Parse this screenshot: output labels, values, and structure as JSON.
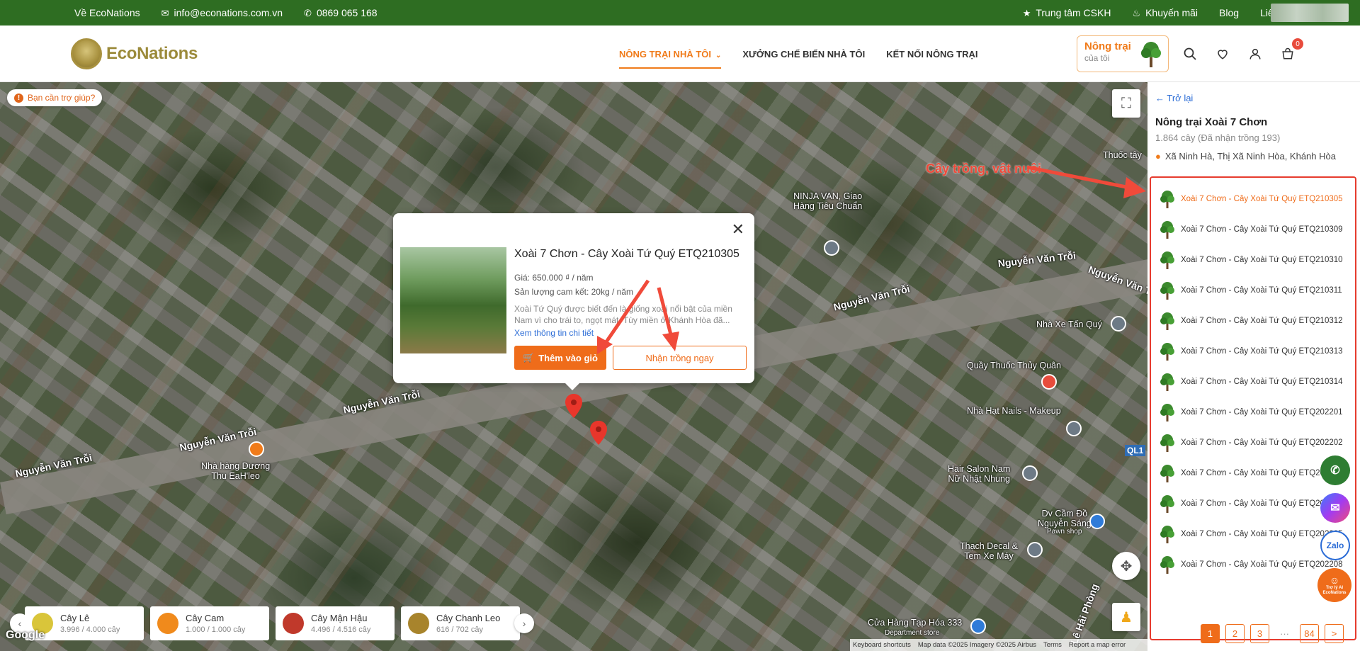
{
  "topbar": {
    "about": "Về EcoNations",
    "email": "info@econations.com.vn",
    "phone": "0869 065 168",
    "support": "Trung tâm CSKH",
    "promo": "Khuyến mãi",
    "blog": "Blog",
    "contact": "Liên hệ"
  },
  "header": {
    "brand": "EcoNations",
    "nav": [
      "NÔNG TRẠI NHÀ TÔI",
      "XƯỞNG CHẾ BIẾN NHÀ TÔI",
      "KẾT NỐI NÔNG TRẠI"
    ],
    "myfarm_title": "Nông trại",
    "myfarm_sub": "của tôi",
    "cart_count": "0"
  },
  "map": {
    "help": "Bạn cần trợ giúp?",
    "roads": [
      "Nguyễn Văn Trỗi",
      "Nguyễn Văn Trỗi",
      "Nguyễn Văn Trỗi",
      "Nguyễn Văn Trỗi",
      "Nguyễn Văn Trỗi",
      "Nguyễn Văn Trỗi",
      "Lê Hải Phòng",
      "QL1"
    ],
    "places": {
      "ninja": "NINJA VAN, Giao\nHàng Tiêu Chuẩn",
      "thuoc_tay": "Thuốc tây",
      "nha_xe": "Nhà Xe Tấn Quý",
      "quay_thuoc": "Quầy Thuốc Thủy Quân",
      "nails": "Nhà Hạt Nails - Makeup",
      "nha_hang": "Nhà hàng Dương\nThu EaH'leo",
      "hair": "Hair Salon Nam\nNữ Nhật Nhung",
      "cam_do": "Dv Cầm Đồ\nNguyễn Sáng",
      "pawn": "Pawn shop",
      "decal": "Thạch Decal &\nTem Xe Máy",
      "tap_hoa": "Cửa Hàng Tạp Hóa 333",
      "dept": "Department store"
    },
    "annotation": "Cây trồng, vật nuôi",
    "footer": [
      "Keyboard shortcuts",
      "Map data ©2025 Imagery ©2025 Airbus",
      "Terms",
      "Report a map error"
    ],
    "google": "Google"
  },
  "popup": {
    "title": "Xoài 7 Chơn - Cây Xoài Tứ Quý ETQ210305",
    "price": "Giá: 650.000 ₫ / năm",
    "yield": "Sản lượng cam kết: 20kg / năm",
    "desc": "Xoài Tứ Quý được biết đến là giống xoài nổi bật của miền Nam vì cho trái to, ngọt mát. Tùy miền ở Khánh Hòa đã...",
    "more": "Xem thông tin chi tiết",
    "add_cart": "Thêm vào giỏ",
    "plant_now": "Nhận trồng ngay"
  },
  "crops": [
    {
      "name": "Cây Lê",
      "count": "3.996 / 4.000 cây",
      "color": "#d9c53a"
    },
    {
      "name": "Cây Cam",
      "count": "1.000 / 1.000 cây",
      "color": "#f08a1c"
    },
    {
      "name": "Cây Mận Hậu",
      "count": "4.496 / 4.516 cây",
      "color": "#c0392b"
    },
    {
      "name": "Cây Chanh Leo",
      "count": "616 / 702 cây",
      "color": "#a8842c"
    }
  ],
  "side": {
    "back": "Trở lại",
    "farm_name": "Nông trại Xoài 7 Chơn",
    "farm_count": "1.864 cây (Đã nhận trồng 193)",
    "farm_addr": "Xã Ninh Hà, Thị Xã Ninh Hòa, Khánh Hòa",
    "items": [
      "Xoài 7 Chơn - Cây Xoài Tứ Quý ETQ210305",
      "Xoài 7 Chơn - Cây Xoài Tứ Quý ETQ210309",
      "Xoài 7 Chơn - Cây Xoài Tứ Quý ETQ210310",
      "Xoài 7 Chơn - Cây Xoài Tứ Quý ETQ210311",
      "Xoài 7 Chơn - Cây Xoài Tứ Quý ETQ210312",
      "Xoài 7 Chơn - Cây Xoài Tứ Quý ETQ210313",
      "Xoài 7 Chơn - Cây Xoài Tứ Quý ETQ210314",
      "Xoài 7 Chơn - Cây Xoài Tứ Quý ETQ202201",
      "Xoài 7 Chơn - Cây Xoài Tứ Quý ETQ202202",
      "Xoài 7 Chơn - Cây Xoài Tứ Quý ETQ202203",
      "Xoài 7 Chơn - Cây Xoài Tứ Quý ETQ202204",
      "Xoài 7 Chơn - Cây Xoài Tứ Quý ETQ202205",
      "Xoài 7 Chơn - Cây Xoài Tứ Quý ETQ202208"
    ],
    "pages": [
      "1",
      "2",
      "3",
      "···",
      "84"
    ],
    "next": ">"
  },
  "fabs": {
    "zalo": "Zalo",
    "ai": "Trợ lý AI EcoNations"
  },
  "colors": {
    "green": "#2e6d22",
    "accent": "#ef6c1a",
    "highlight": "#e63b2e"
  }
}
